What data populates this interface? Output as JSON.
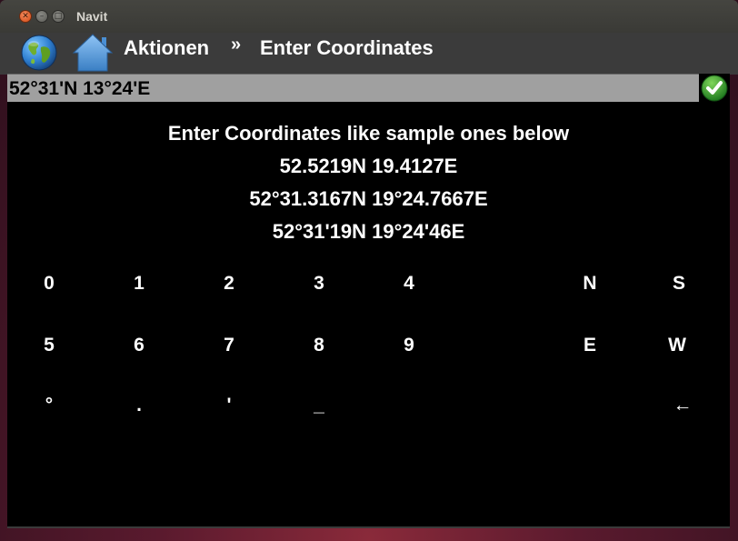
{
  "window": {
    "title": "Navit"
  },
  "toolbar": {
    "icons": {
      "globe": "globe-icon",
      "home": "home-icon"
    },
    "breadcrumb": {
      "first": "Aktionen",
      "separator": "»",
      "current": "Enter Coordinates"
    }
  },
  "input": {
    "value": "52°31'N 13°24'E"
  },
  "confirm": {
    "icon": "checkmark-icon",
    "color": "#2f9a2f"
  },
  "instructions": {
    "heading": "Enter Coordinates like sample ones below",
    "samples": [
      "52.5219N 19.4127E",
      "52°31.3167N 19°24.7667E",
      "52°31'19N 19°24'46E"
    ]
  },
  "keypad": {
    "row1": [
      "0",
      "1",
      "2",
      "3",
      "4",
      "N",
      "S"
    ],
    "row2": [
      "5",
      "6",
      "7",
      "8",
      "9",
      "E",
      "W"
    ],
    "row3": [
      "°",
      ".",
      "'",
      "_",
      "←"
    ]
  }
}
